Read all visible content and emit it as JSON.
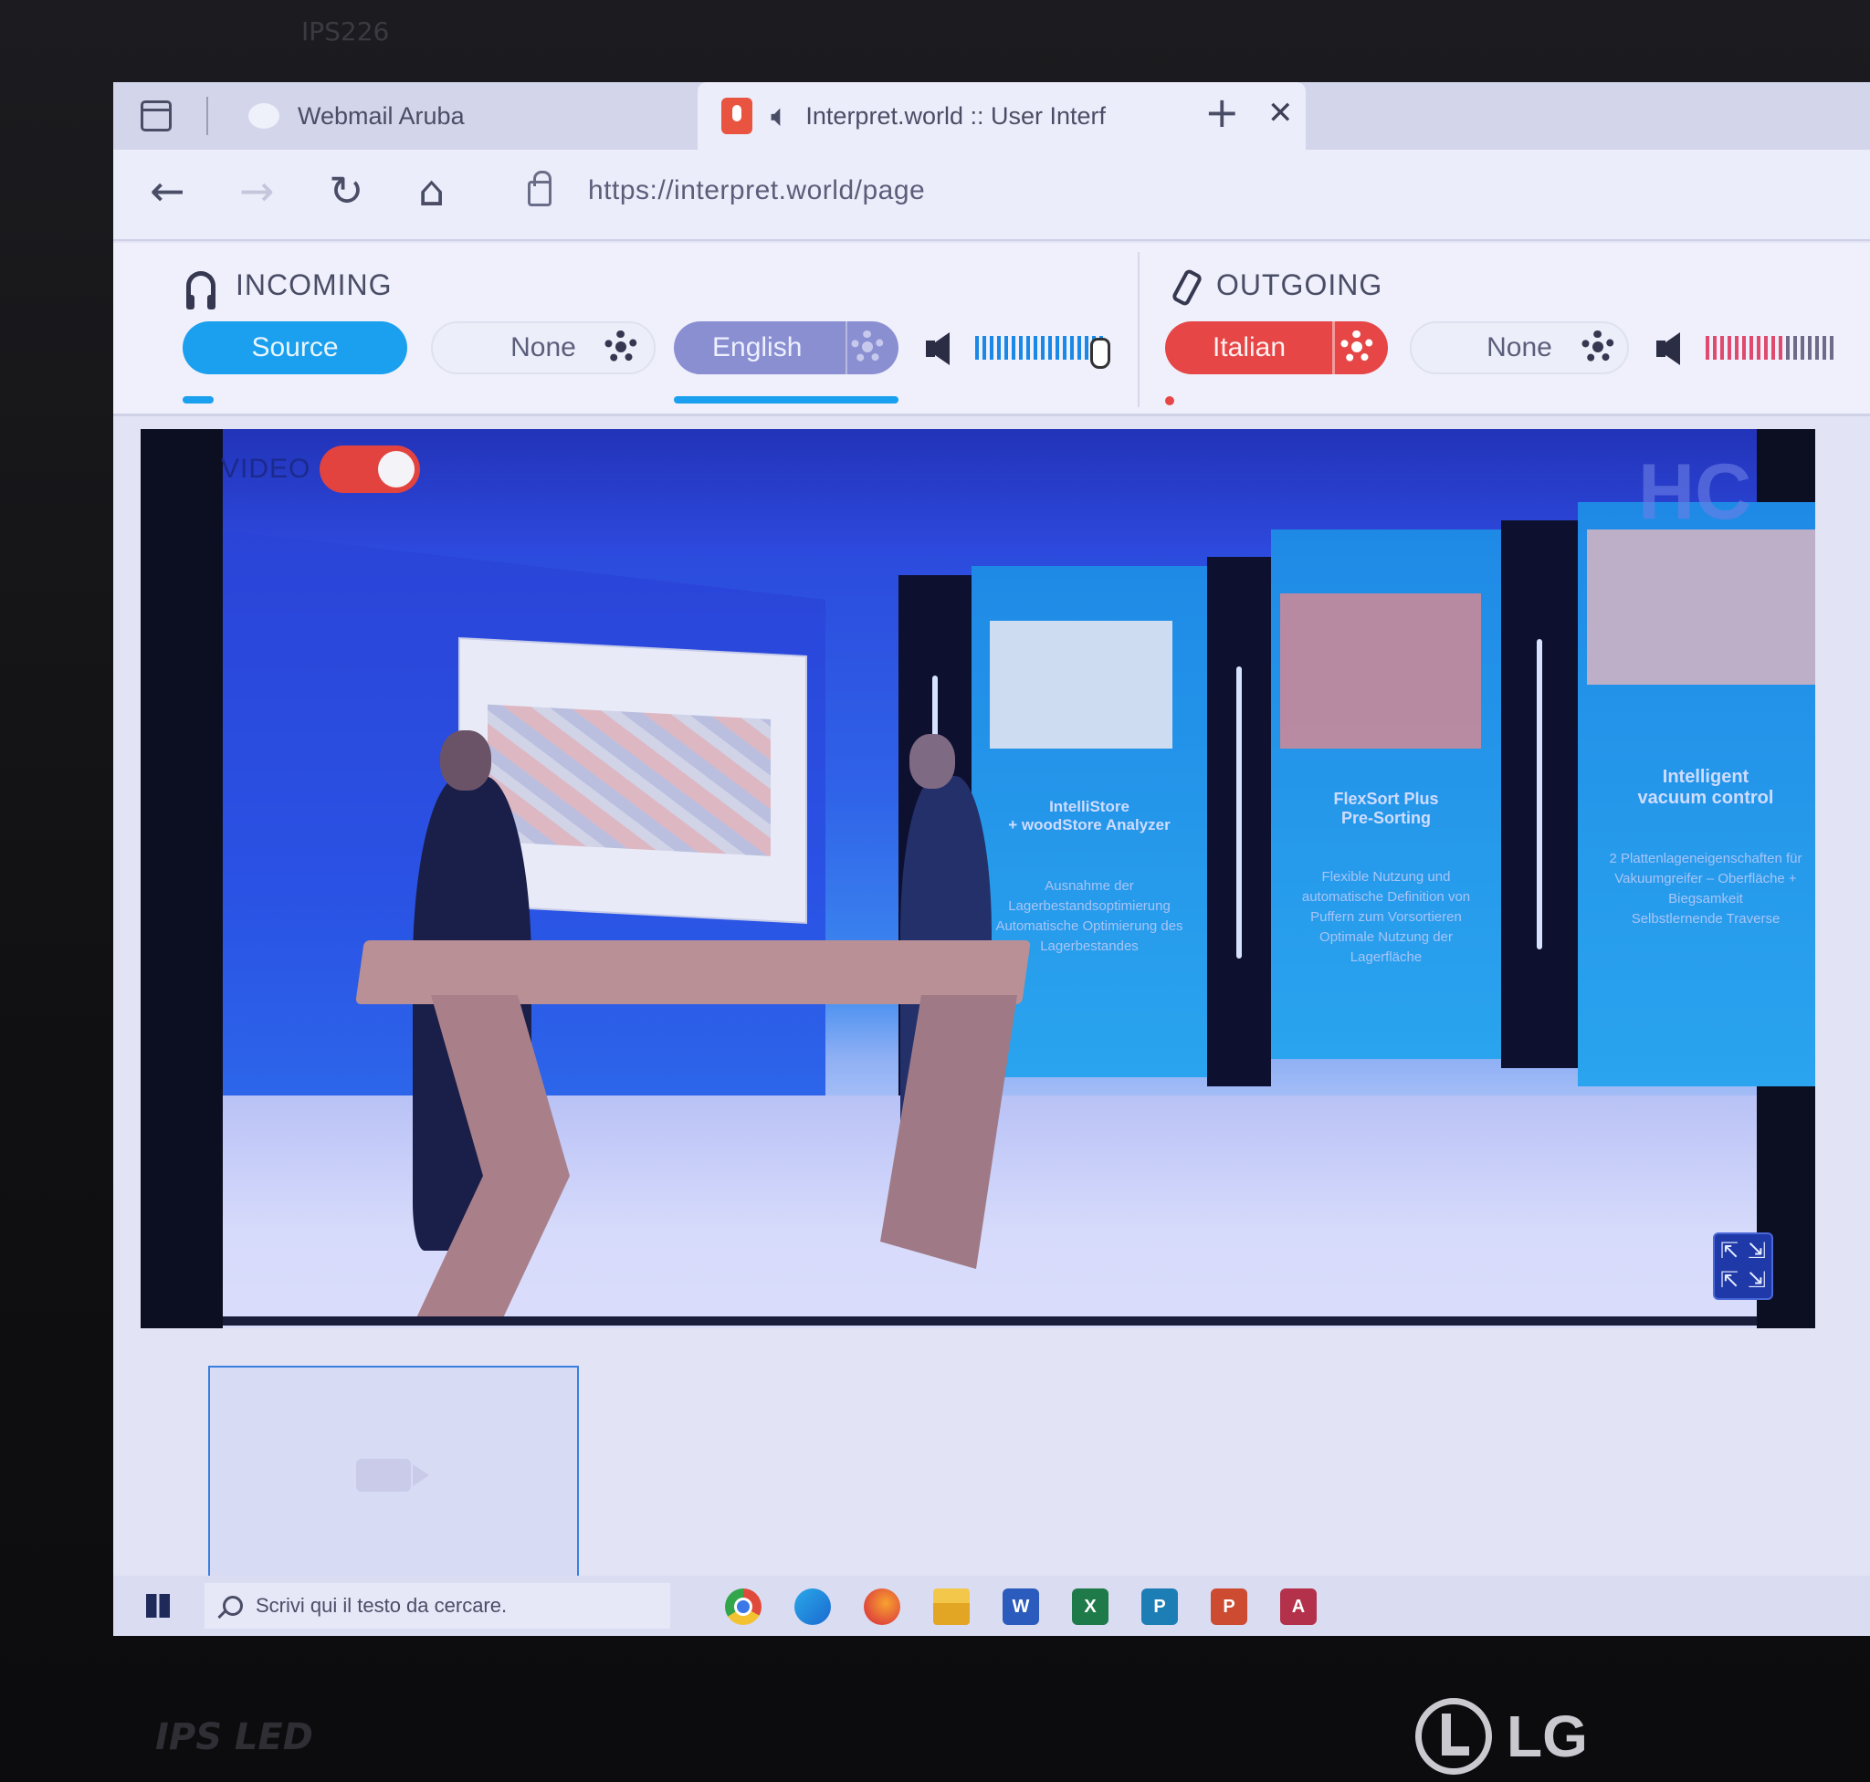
{
  "monitor": {
    "top_model": "IPS226",
    "bottom_label": "IPS LED",
    "brand": "LG"
  },
  "browser": {
    "tabs": [
      {
        "title": "Webmail Aruba",
        "active": false
      },
      {
        "title": "Interpret.world :: User Interf",
        "active": true
      }
    ],
    "url": "https://interpret.world/page"
  },
  "interpret": {
    "incoming": {
      "title": "INCOMING",
      "source_label": "Source",
      "none_label": "None",
      "language_label": "English",
      "volume_level_percent": 100
    },
    "outgoing": {
      "title": "OUTGOING",
      "language_label": "Italian",
      "none_label": "None",
      "volume_level_percent": 60
    },
    "accent_blue": "#1aa0ee",
    "accent_red": "#e64646",
    "accent_purple": "#8a8fd2"
  },
  "video": {
    "toggle_label": "VIDEO",
    "toggle_on": true,
    "logo": "HC",
    "boards": [
      {
        "title": "IntelliStore\n+ woodStore Analyzer",
        "body": "Ausnahme der Lagerbestandsoptimierung\nAutomatische Optimierung des Lagerbestandes"
      },
      {
        "title": "FlexSort Plus\nPre-Sorting",
        "body": "Flexible Nutzung und automatische Definition von Puffern zum Vorsortieren\nOptimale Nutzung der Lagerfläche"
      },
      {
        "title": "Intelligent\nvacuum control",
        "body": "2 Plattenlageneigenschaften für Vakuumgreifer – Oberfläche + Biegsamkeit\nSelbstlernende Traverse"
      }
    ]
  },
  "taskbar": {
    "search_placeholder": "Scrivi qui il testo da cercare.",
    "apps": [
      "chrome-icon",
      "edge-icon",
      "firefox-icon",
      "file-explorer-icon",
      "word-icon",
      "excel-icon",
      "publisher-icon",
      "powerpoint-icon",
      "access-icon"
    ],
    "app_letters": {
      "word": "W",
      "excel": "X",
      "publisher": "P",
      "powerpoint": "P",
      "access": "A"
    }
  }
}
